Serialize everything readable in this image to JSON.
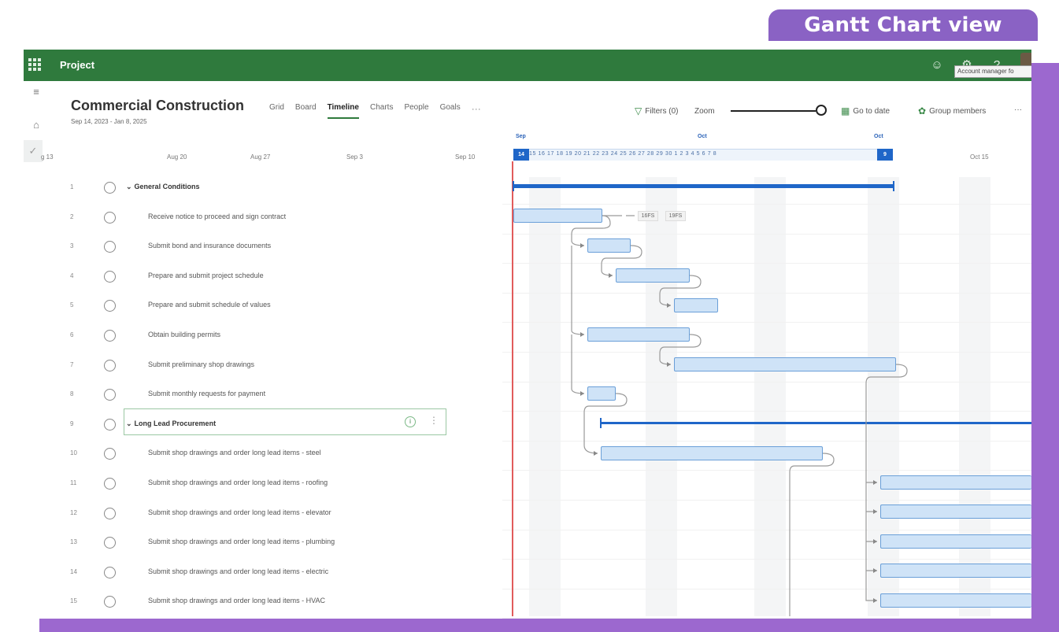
{
  "badge": "Gantt Chart view",
  "app": {
    "name": "Project",
    "tooltip": "Account manager fo"
  },
  "project": {
    "title": "Commercial Construction",
    "dates": "Sep 14, 2023 - Jan 8, 2025"
  },
  "tabs": [
    "Grid",
    "Board",
    "Timeline",
    "Charts",
    "People",
    "Goals"
  ],
  "active_tab": "Timeline",
  "toolbar": {
    "filters": "Filters (0)",
    "zoom": "Zoom",
    "go_to_date": "Go to date",
    "group_members": "Group members",
    "more": "···"
  },
  "week_labels": [
    "g 13",
    "Aug 20",
    "Aug 27",
    "Sep 3",
    "Sep 10"
  ],
  "month_labels": [
    "Sep",
    "Oct",
    "Oct"
  ],
  "days_start": "14",
  "days": "15 16 17 18 19 20 21 22 23 24 25 26 27 28 29 30 1 2 3 4 5 6 7 8",
  "days_end": "9",
  "right_week": "Oct 15",
  "lag_labels": [
    "16FS",
    "19FS"
  ],
  "tasks": [
    {
      "num": "1",
      "name": "General Conditions",
      "summary": true
    },
    {
      "num": "2",
      "name": "Receive notice to proceed and sign contract",
      "summary": false
    },
    {
      "num": "3",
      "name": "Submit bond and insurance documents",
      "summary": false
    },
    {
      "num": "4",
      "name": "Prepare and submit project schedule",
      "summary": false
    },
    {
      "num": "5",
      "name": "Prepare and submit schedule of values",
      "summary": false
    },
    {
      "num": "6",
      "name": "Obtain building permits",
      "summary": false
    },
    {
      "num": "7",
      "name": "Submit preliminary shop drawings",
      "summary": false
    },
    {
      "num": "8",
      "name": "Submit monthly requests for payment",
      "summary": false
    },
    {
      "num": "9",
      "name": "Long Lead Procurement",
      "summary": true
    },
    {
      "num": "10",
      "name": "Submit shop drawings and order long lead items - steel",
      "summary": false
    },
    {
      "num": "11",
      "name": "Submit shop drawings and order long lead items - roofing",
      "summary": false
    },
    {
      "num": "12",
      "name": "Submit shop drawings and order long lead items - elevator",
      "summary": false
    },
    {
      "num": "13",
      "name": "Submit shop drawings and order long lead items - plumbing",
      "summary": false
    },
    {
      "num": "14",
      "name": "Submit shop drawings and order long lead items - electric",
      "summary": false
    },
    {
      "num": "15",
      "name": "Submit shop drawings and order long lead items - HVAC",
      "summary": false
    }
  ],
  "colors": {
    "topbar": "#2f7a3d",
    "frame": "#9c68cf",
    "bar_fill": "#cfe3f7",
    "summary_bar": "#1f66c8",
    "today_line": "#e15b5b"
  }
}
